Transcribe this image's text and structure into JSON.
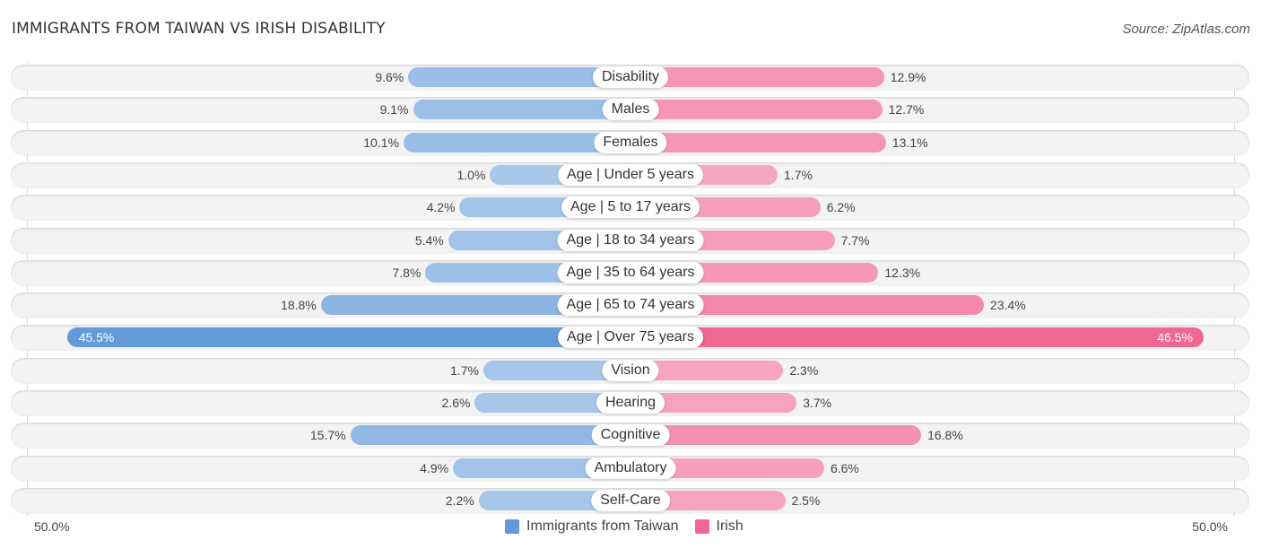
{
  "header": {
    "title": "IMMIGRANTS FROM TAIWAN VS IRISH DISABILITY",
    "source": "Source: ZipAtlas.com"
  },
  "colors": {
    "left_light": "#a9c8eb",
    "left_strong": "#6199d9",
    "right_light": "#f7a8c2",
    "right_strong": "#f06792"
  },
  "chart_data": {
    "type": "bar",
    "orientation": "horizontal-diverging",
    "title": "IMMIGRANTS FROM TAIWAN VS IRISH DISABILITY",
    "categories": [
      "Disability",
      "Males",
      "Females",
      "Age | Under 5 years",
      "Age | 5 to 17 years",
      "Age | 18 to 34 years",
      "Age | 35 to 64 years",
      "Age | 65 to 74 years",
      "Age | Over 75 years",
      "Vision",
      "Hearing",
      "Cognitive",
      "Ambulatory",
      "Self-Care"
    ],
    "series": [
      {
        "name": "Immigrants from Taiwan",
        "side": "left",
        "values": [
          9.6,
          9.1,
          10.1,
          1.0,
          4.2,
          5.4,
          7.8,
          18.8,
          45.5,
          1.7,
          2.6,
          15.7,
          4.9,
          2.2
        ],
        "labels": [
          "9.6%",
          "9.1%",
          "10.1%",
          "1.0%",
          "4.2%",
          "5.4%",
          "7.8%",
          "18.8%",
          "45.5%",
          "1.7%",
          "2.6%",
          "15.7%",
          "4.9%",
          "2.2%"
        ]
      },
      {
        "name": "Irish",
        "side": "right",
        "values": [
          12.9,
          12.7,
          13.1,
          1.7,
          6.2,
          7.7,
          12.3,
          23.4,
          46.5,
          2.3,
          3.7,
          16.8,
          6.6,
          2.5
        ],
        "labels": [
          "12.9%",
          "12.7%",
          "13.1%",
          "1.7%",
          "6.2%",
          "7.7%",
          "12.3%",
          "23.4%",
          "46.5%",
          "2.3%",
          "3.7%",
          "16.8%",
          "6.6%",
          "2.5%"
        ]
      }
    ],
    "axis": {
      "min_label": "50.0%",
      "max_label": "50.0%",
      "range": [
        0,
        50
      ]
    },
    "legend": {
      "position": "bottom-center",
      "entries": [
        "Immigrants from Taiwan",
        "Irish"
      ]
    }
  }
}
